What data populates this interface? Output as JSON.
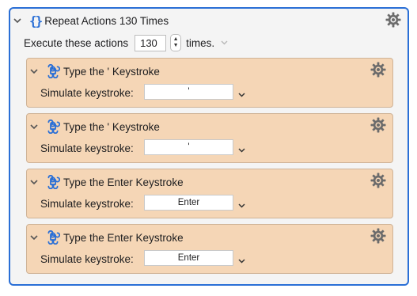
{
  "repeat": {
    "title": "Repeat Actions 130 Times",
    "repeat_icon": "{}",
    "execute_label": "Execute these actions",
    "count": "130",
    "times_label": "times."
  },
  "actions": [
    {
      "title": "Type the ' Keystroke",
      "label": "Simulate keystroke:",
      "keystroke": "'"
    },
    {
      "title": "Type the ' Keystroke",
      "label": "Simulate keystroke:",
      "keystroke": "'"
    },
    {
      "title": "Type the Enter Keystroke",
      "label": "Simulate keystroke:",
      "keystroke": "Enter"
    },
    {
      "title": "Type the Enter Keystroke",
      "label": "Simulate keystroke:",
      "keystroke": "Enter"
    }
  ],
  "icons": {
    "disclosure": "chevron-down-icon",
    "action": "command-key-icon",
    "settings": "gear-icon",
    "stepper": "stepper-icon"
  },
  "colors": {
    "accent": "#2a6fd6",
    "action_background": "#f5d6b6",
    "command_icon": "#2a6fd6"
  }
}
